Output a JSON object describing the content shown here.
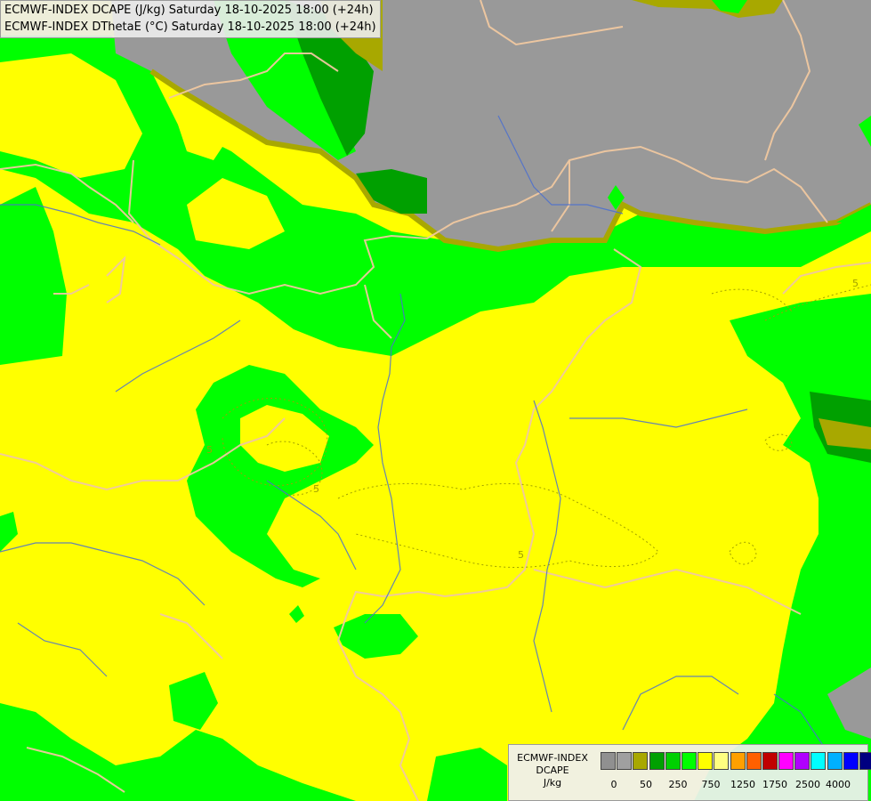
{
  "titles": {
    "line1": "ECMWF-INDEX DCAPE (J/kg) Saturday 18-10-2025 18:00 (+24h)",
    "line2": "ECMWF-INDEX DThetaE (°C) Saturday 18-10-2025 18:00 (+24h)"
  },
  "colors": {
    "no_data_gray": "#999999",
    "olive": "#a8a800",
    "dark_green": "#00a000",
    "green": "#00ff00",
    "yellow": "#ffff00",
    "border_line": "#f0c8a0",
    "river_line": "#4a6fd0",
    "contour_line": "#a0a000"
  },
  "legend": {
    "title_line1": "ECMWF-INDEX",
    "title_line2": "DCAPE",
    "unit": "J/kg",
    "swatches": [
      "#909090",
      "#a0a0a0",
      "#a8a800",
      "#00a000",
      "#00d000",
      "#00ff00",
      "#ffff00",
      "#ffff80",
      "#ffa000",
      "#ff6000",
      "#c00000",
      "#ff00ff",
      "#b000ff",
      "#00ffff",
      "#00b0ff",
      "#0000ff",
      "#000080"
    ],
    "tick_labels": [
      "0",
      "50",
      "250",
      "750",
      "1250",
      "1750",
      "2500",
      "4000"
    ]
  },
  "contour_labels": [
    "5",
    "5",
    "5",
    "5"
  ]
}
